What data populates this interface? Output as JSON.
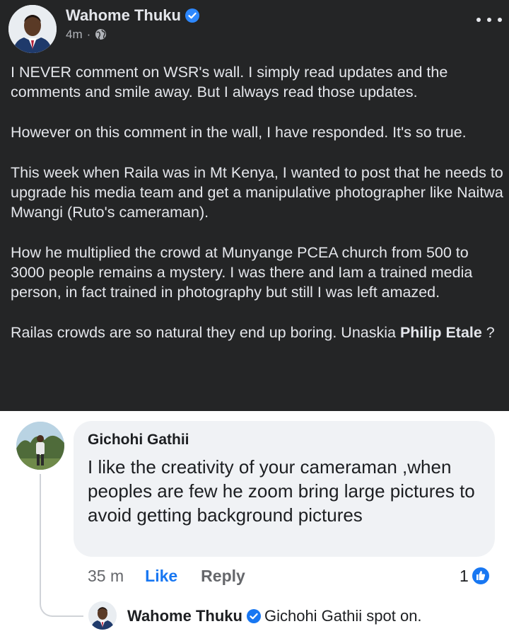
{
  "post": {
    "author": "Wahome Thuku",
    "time": "4m",
    "meta_separator": "·",
    "paragraphs": [
      "I NEVER comment on WSR's wall. I simply read updates and the comments and smile away. But I always read those updates.",
      "However on this comment in the wall, I have responded. It's so true.",
      "This week when Raila was in Mt Kenya, I wanted to post that he needs to upgrade his media team and get a manipulative photographer like Naitwa Mwangi (Ruto's cameraman).",
      "How he multiplied the crowd at Munyange PCEA church from 500 to 3000 people remains a mystery. I was there and Iam a trained media person, in fact trained in photography but still I was left amazed."
    ],
    "last_paragraph_text": "Railas crowds are so natural they end up boring. Unaskia ",
    "last_paragraph_mention": "Philip Etale",
    "last_paragraph_suffix": " ?",
    "icons": {
      "verified": "verified-badge-icon",
      "audience": "globe-icon",
      "more": "more-options-icon"
    }
  },
  "comment": {
    "author": "Gichohi Gathii",
    "text": "I like the creativity of your cameraman ,when peoples are few he zoom bring large pictures to avoid getting background pictures",
    "time": "35 m",
    "like_label": "Like",
    "reply_label": "Reply",
    "reaction_count": "1",
    "reaction_icon": "like-reaction-icon"
  },
  "reply": {
    "author": "Wahome Thuku",
    "text": "Gichohi Gathii spot on."
  },
  "colors": {
    "post_background": "#242526",
    "post_text": "#e4e6eb",
    "comment_bubble": "#f0f2f5",
    "link_blue": "#1877f2",
    "muted_text": "#65676b"
  }
}
